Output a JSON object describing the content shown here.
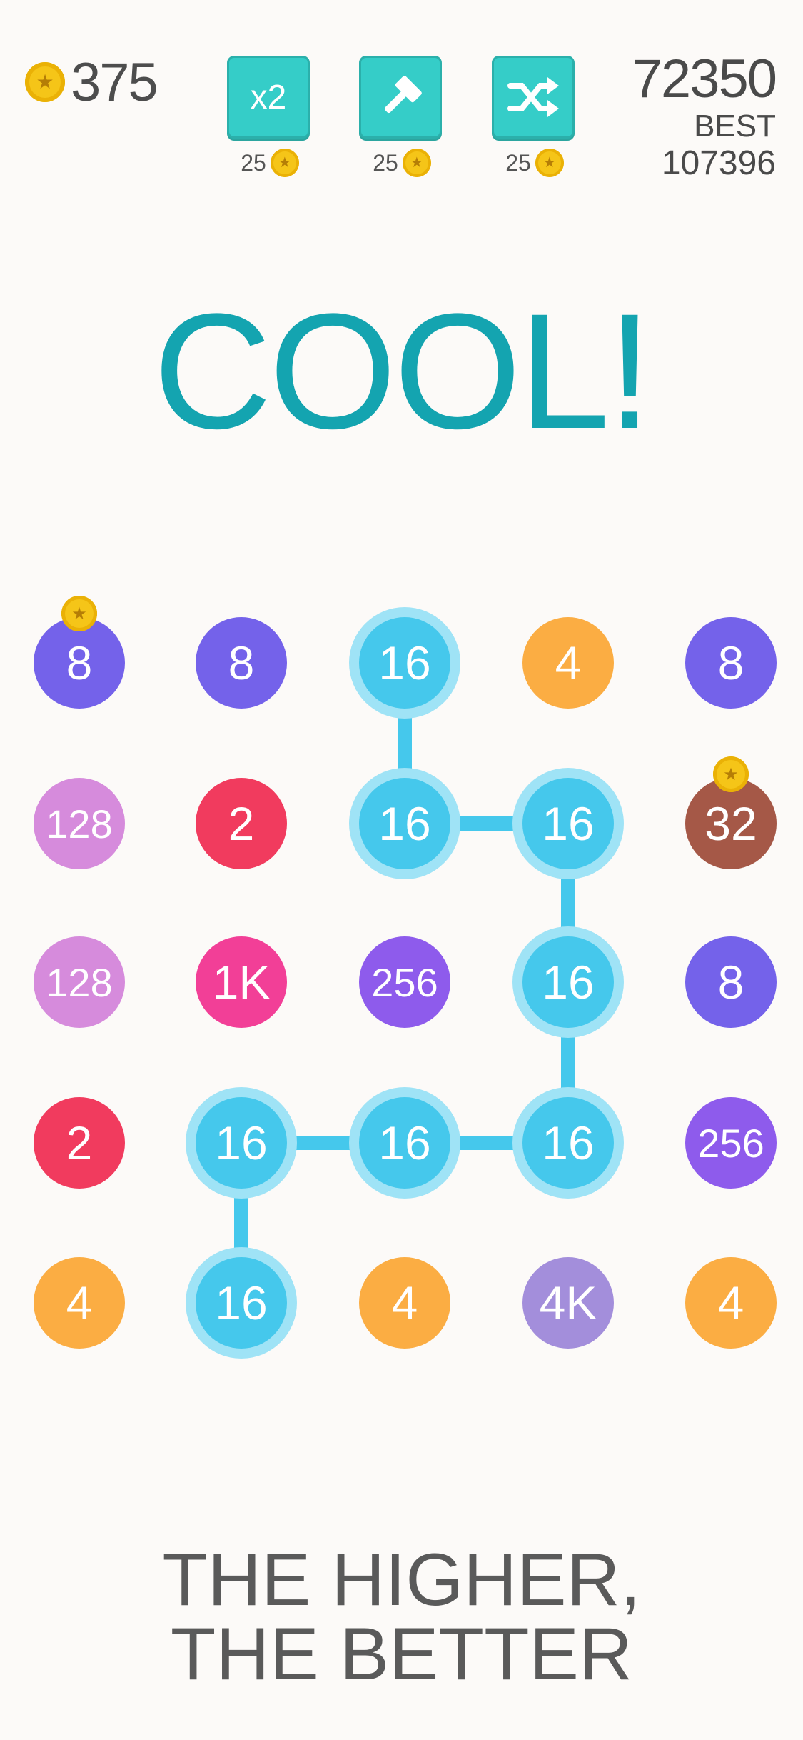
{
  "coins": {
    "icon": "star-coin-icon",
    "value": "375"
  },
  "powerups": [
    {
      "name": "double",
      "label": "x2",
      "icon": "",
      "cost": "25"
    },
    {
      "name": "hammer",
      "label": "",
      "icon": "hammer-icon",
      "cost": "25"
    },
    {
      "name": "shuffle",
      "label": "",
      "icon": "shuffle-icon",
      "cost": "25"
    }
  ],
  "score": {
    "current": "72350",
    "best_label": "BEST",
    "best": "107396"
  },
  "banner": "COOL!",
  "colors": {
    "8": "#7462ea",
    "16": "#45c8ec",
    "4": "#fbad43",
    "128": "#d68bdc",
    "2": "#f13b5e",
    "32": "#a55847",
    "1K": "#f23f97",
    "256": "#8e5bec",
    "4K": "#a38edb",
    "connector": "#45c8ec",
    "halo": "#9fe3f6",
    "accent": "#14a4b0",
    "powerup": "#35cdc8",
    "coin": "#f5c518"
  },
  "grid": {
    "rows": 5,
    "cols": 5,
    "cells": [
      [
        "8",
        "8",
        "16",
        "4",
        "8"
      ],
      [
        "128",
        "2",
        "16",
        "16",
        "32"
      ],
      [
        "128",
        "1K",
        "256",
        "16",
        "8"
      ],
      [
        "2",
        "16",
        "16",
        "16",
        "256"
      ],
      [
        "4",
        "16",
        "4",
        "4K",
        "4"
      ]
    ],
    "coin_badges": [
      [
        0,
        0
      ],
      [
        1,
        4
      ]
    ],
    "selected_path": [
      [
        0,
        2
      ],
      [
        1,
        2
      ],
      [
        1,
        3
      ],
      [
        2,
        3
      ],
      [
        3,
        3
      ],
      [
        3,
        2
      ],
      [
        3,
        1
      ],
      [
        4,
        1
      ]
    ]
  },
  "tagline": {
    "line1": "THE HIGHER,",
    "line2": "THE BETTER"
  }
}
